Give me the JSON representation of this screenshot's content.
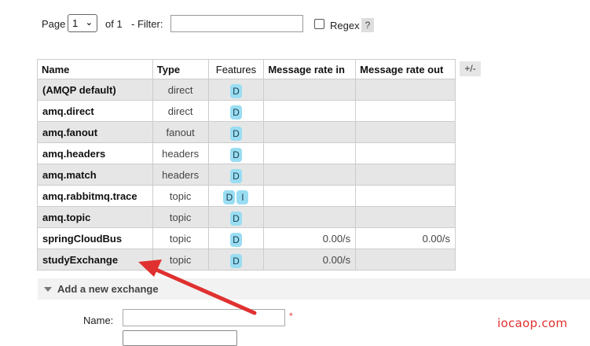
{
  "pagination": {
    "page_label": "Page",
    "page_value": "1",
    "of_label": "of 1",
    "filter_label": "- Filter:",
    "filter_value": "",
    "regex_label": "Regex",
    "regex_checked": false,
    "help_label": "?"
  },
  "table": {
    "headers": [
      "Name",
      "Type",
      "Features",
      "Message rate in",
      "Message rate out"
    ],
    "column_toggle": "+/-",
    "rows": [
      {
        "name": "(AMQP default)",
        "type": "direct",
        "features": [
          "D"
        ],
        "rate_in": "",
        "rate_out": ""
      },
      {
        "name": "amq.direct",
        "type": "direct",
        "features": [
          "D"
        ],
        "rate_in": "",
        "rate_out": ""
      },
      {
        "name": "amq.fanout",
        "type": "fanout",
        "features": [
          "D"
        ],
        "rate_in": "",
        "rate_out": ""
      },
      {
        "name": "amq.headers",
        "type": "headers",
        "features": [
          "D"
        ],
        "rate_in": "",
        "rate_out": ""
      },
      {
        "name": "amq.match",
        "type": "headers",
        "features": [
          "D"
        ],
        "rate_in": "",
        "rate_out": ""
      },
      {
        "name": "amq.rabbitmq.trace",
        "type": "topic",
        "features": [
          "D",
          "I"
        ],
        "rate_in": "",
        "rate_out": ""
      },
      {
        "name": "amq.topic",
        "type": "topic",
        "features": [
          "D"
        ],
        "rate_in": "",
        "rate_out": ""
      },
      {
        "name": "springCloudBus",
        "type": "topic",
        "features": [
          "D"
        ],
        "rate_in": "0.00/s",
        "rate_out": "0.00/s"
      },
      {
        "name": "studyExchange",
        "type": "topic",
        "features": [
          "D"
        ],
        "rate_in": "0.00/s",
        "rate_out": ""
      }
    ]
  },
  "add_exchange": {
    "title": "Add a new exchange",
    "name_label": "Name:",
    "name_value": "",
    "required_mark": "*"
  },
  "watermark": "iocaop.com",
  "colors": {
    "feature_badge": "#99ddf2",
    "row_alt": "#e6e6e6",
    "annotation_arrow": "#e03030"
  }
}
